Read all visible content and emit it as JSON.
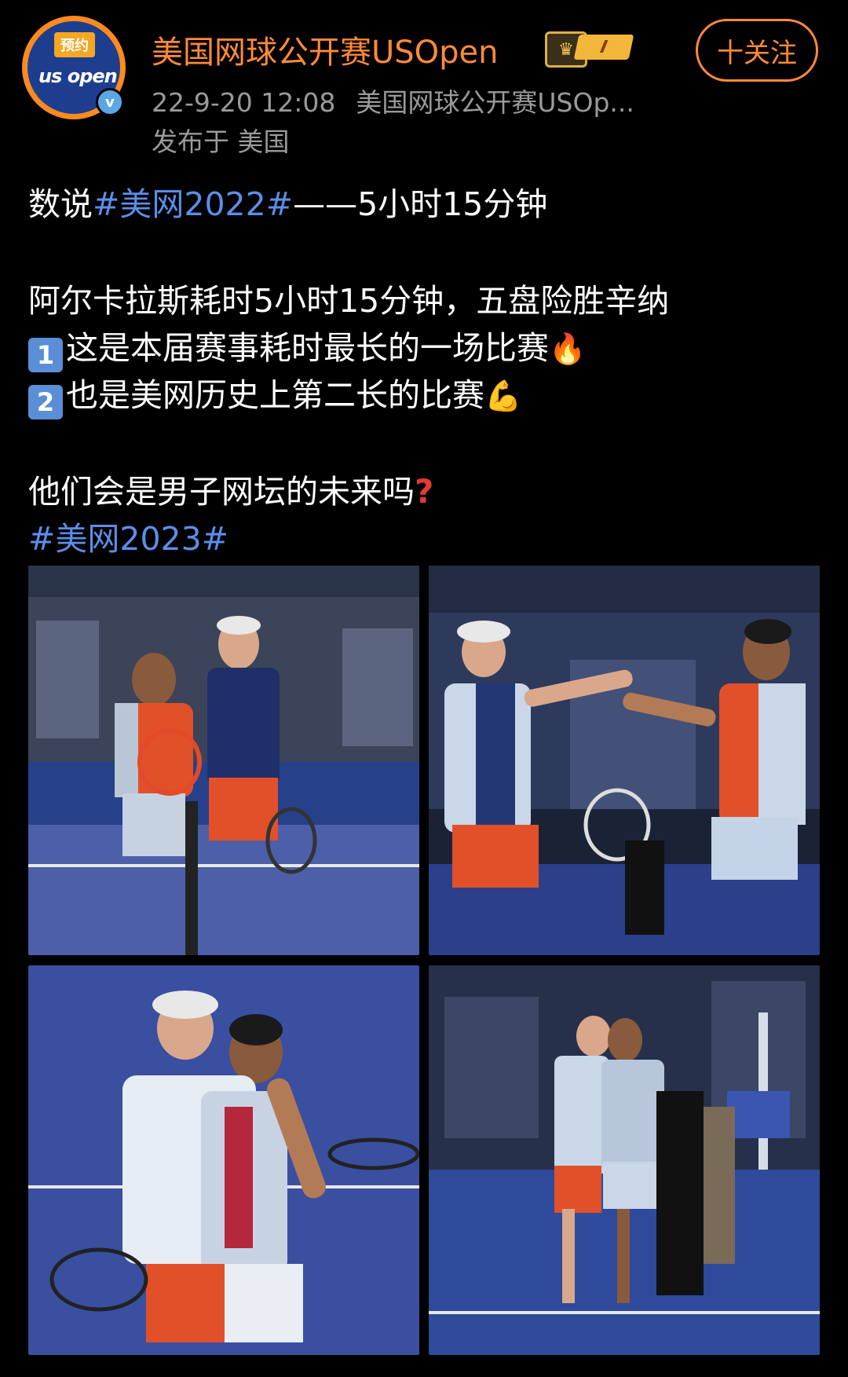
{
  "header": {
    "avatar_tag": "预约",
    "avatar_logo": "us open",
    "verified_mark": "v",
    "account_name": "美国网球公开赛USOpen",
    "badge_level": "I",
    "follow_label": "十关注",
    "timestamp": "22-9-20 12:08",
    "source": "美国网球公开赛USOp...",
    "location": "发布于 美国"
  },
  "post": {
    "line1_prefix": "数说",
    "line1_hashtag": "#美网2022#",
    "line1_suffix": "——5小时15分钟",
    "line2": "阿尔卡拉斯耗时5小时15分钟，五盘险胜辛纳",
    "item1_num": "1",
    "item1_text": "这是本届赛事耗时最长的一场比赛",
    "item2_num": "2",
    "item2_text": "也是美网历史上第二长的比赛",
    "line5": "他们会是男子网坛的未来吗",
    "hashtag2": "#美网2023#"
  },
  "icons": {
    "fire": "fire-icon",
    "muscle": "flexed-biceps-icon",
    "question": "question-mark-icon"
  },
  "colors": {
    "accent_orange": "#ff8a3a",
    "hashtag_blue": "#5b8ee8",
    "meta_gray": "#9a9a9a",
    "court_blue": "#3a4fa0"
  }
}
